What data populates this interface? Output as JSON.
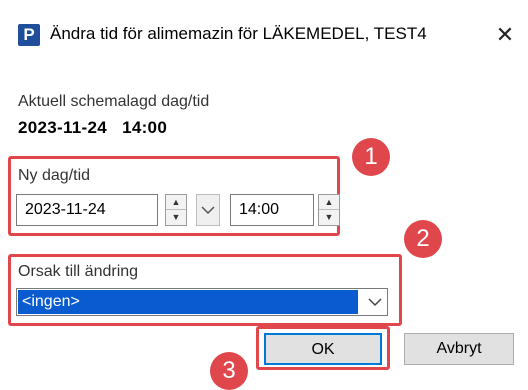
{
  "window": {
    "app_icon_letter": "P",
    "title": "Ändra tid för alimemazin för LÄKEMEDEL, TEST4",
    "close_glyph": "✕"
  },
  "current": {
    "label": "Aktuell schemalagd dag/tid",
    "value": "2023-11-24   14:00"
  },
  "new_datetime": {
    "label": "Ny dag/tid",
    "date_value": "2023-11-24",
    "time_value": "14:00"
  },
  "reason": {
    "label": "Orsak till ändring",
    "selected": "<ingen>"
  },
  "buttons": {
    "ok": "OK",
    "cancel": "Avbryt"
  },
  "badges": [
    "1",
    "2",
    "3"
  ],
  "colors": {
    "highlight": "#e0474c",
    "selection": "#0a5ad0",
    "app_icon": "#1f4e9b"
  },
  "icons": {
    "spin_up": "▲",
    "spin_down": "▼",
    "chevron_down": "⌵"
  }
}
